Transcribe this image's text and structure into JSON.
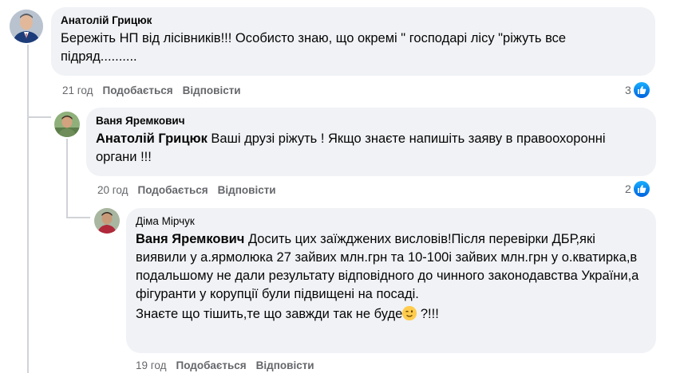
{
  "comments": [
    {
      "author": "Анатолій Грицюк",
      "text": "Бережіть НП від лісівників!!! Особисто знаю, що окремі \" господарі лісу \"ріжуть все підряд..........",
      "time": "21 год",
      "like_label": "Подобається",
      "reply_label": "Відповісти",
      "reaction_count": "3",
      "reaction_icon": "like-icon"
    },
    {
      "author": "Ваня Яремкович",
      "mention": "Анатолій Грицюк",
      "text": " Ваші друзі ріжуть ! Якщо знаєте напишіть заяву в правоохоронні органи !!!",
      "time": "20 год",
      "like_label": "Подобається",
      "reply_label": "Відповісти",
      "reaction_count": "2",
      "reaction_icon": "like-icon"
    },
    {
      "author": "Діма Мірчук",
      "mention": "Ваня Яремкович",
      "text": " Досить цих заїжджених висловів!Після перевірки ДБР,які виявили у а.ярмолюка 27 зайвих млн.грн та 10-100і зайвих млн.грн у о.кватирка,в подальшому не дали результату відповідного до чинного законодавства України,а фігуранти у корупції були підвищені на посаді.",
      "text2_before": "Знаєте що тішить,те що завжди так не буде",
      "text2_after": " ?!!!",
      "emoji": "winking-face-emoji",
      "time": "19 год",
      "like_label": "Подобається",
      "reply_label": "Відповісти"
    }
  ],
  "colors": {
    "bubble": "#f0f2f5",
    "meta": "#65676b",
    "like_blue": "#0866ff",
    "thread_line": "#d0d3d8"
  }
}
